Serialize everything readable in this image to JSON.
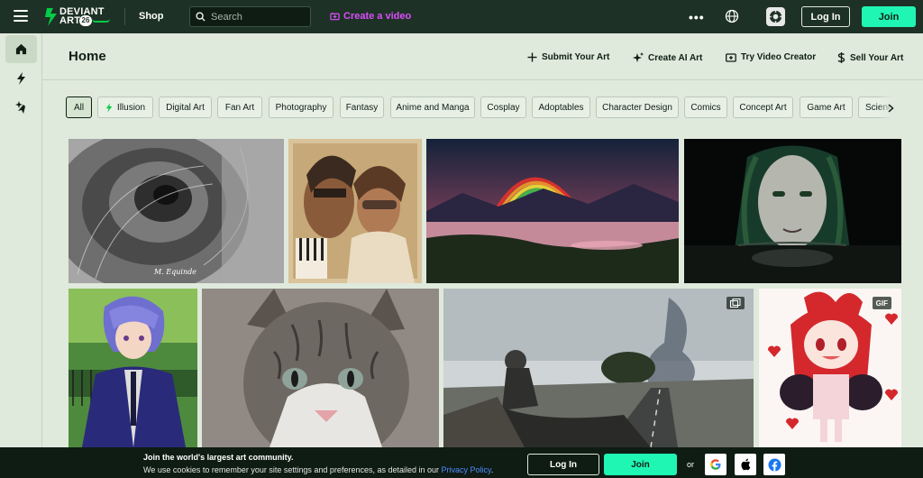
{
  "topbar": {
    "logo_text": "DEVIANT ART",
    "logo_line1": "DEVIANT",
    "logo_line2": "ART",
    "logo_badge": "26",
    "shop": "Shop",
    "search_placeholder": "Search",
    "create_video": "Create a video",
    "more": "•••",
    "login": "Log In",
    "join": "Join"
  },
  "sidebar": {
    "items": [
      "home-icon",
      "lightning-icon",
      "sparkle-icon"
    ]
  },
  "header": {
    "title": "Home",
    "actions": [
      {
        "label": "Submit Your Art",
        "icon": "plus-icon"
      },
      {
        "label": "Create AI Art",
        "icon": "sparkle-icon"
      },
      {
        "label": "Try Video Creator",
        "icon": "video-plus-icon"
      },
      {
        "label": "Sell Your Art",
        "icon": "dollar-icon"
      }
    ]
  },
  "chips": [
    {
      "label": "All",
      "active": true
    },
    {
      "label": "Illusion",
      "icon": "lightning-icon"
    },
    {
      "label": "Digital Art"
    },
    {
      "label": "Fan Art"
    },
    {
      "label": "Photography"
    },
    {
      "label": "Fantasy"
    },
    {
      "label": "Anime and Manga"
    },
    {
      "label": "Cosplay"
    },
    {
      "label": "Adoptables"
    },
    {
      "label": "Character Design"
    },
    {
      "label": "Comics"
    },
    {
      "label": "Concept Art"
    },
    {
      "label": "Game Art"
    },
    {
      "label": "Science F"
    }
  ],
  "gallery": {
    "tiles": [
      {
        "name": "spiral-staircase-sketch",
        "signature": "M. Equinde"
      },
      {
        "name": "retro-musician-portrait"
      },
      {
        "name": "rainbow-lake-landscape"
      },
      {
        "name": "dark-water-woman-portrait"
      },
      {
        "name": "anime-boy-blue-suit"
      },
      {
        "name": "tabby-cat-portrait"
      },
      {
        "name": "surreal-road-peeling",
        "badge_icon": "multi-image-icon"
      },
      {
        "name": "red-hair-chibi-girl",
        "badge": "GIF"
      }
    ]
  },
  "cookie": {
    "title": "Join the world's largest art community.",
    "text": "We use cookies to remember your site settings and preferences, as detailed in our",
    "link": "Privacy Policy",
    "end": ".",
    "login": "Log In",
    "join": "Join",
    "or": "or",
    "sso": [
      "google-icon",
      "apple-icon",
      "facebook-icon"
    ]
  },
  "colors": {
    "topbar_bg": "#1e3126",
    "page_bg": "#dfe9dc",
    "accent_green": "#1ff6b4",
    "create_video_purple": "#d94ffa",
    "cookie_bg": "#0f1c14",
    "link_blue": "#4d8dff"
  }
}
